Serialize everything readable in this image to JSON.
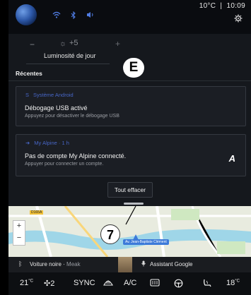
{
  "status": {
    "temperature": "10°C",
    "time": "10:09",
    "quick_icons": [
      "wifi-icon",
      "bluetooth-icon",
      "speaker-icon"
    ]
  },
  "brightness": {
    "minus": "−",
    "value": "+5",
    "plus": "+",
    "label": "Luminosité de jour"
  },
  "marker_e": "E",
  "recent": {
    "title": "Récentes",
    "notifications": [
      {
        "app": "Système Android",
        "title": "Débogage USB activé",
        "subtitle": "Appuyez pour désactiver le débogage USB"
      },
      {
        "app": "My Alpine · 1 h",
        "title": "Pas de compte My Alpine connecté.",
        "subtitle": "Appuyer pour connecter un compte.",
        "logo": "A"
      }
    ],
    "clear_all": "Tout effacer"
  },
  "marker_7": "7",
  "map": {
    "road_sign": "D165A",
    "street": "Av. Jean-Baptiste Clément",
    "zoom_in": "+",
    "zoom_out": "−"
  },
  "media": {
    "source": "Voiture noire",
    "artist": "Meak",
    "assistant": "Assistant Google"
  },
  "climate": {
    "left_temp": "21",
    "left_unit": "°C",
    "fan_level": "2",
    "sync": "SYNC",
    "ac": "A/C",
    "right_temp": "18",
    "right_unit": "°C"
  },
  "colors": {
    "accent": "#4f7be0",
    "panel": "#15181d",
    "card": "#1b1e24"
  }
}
